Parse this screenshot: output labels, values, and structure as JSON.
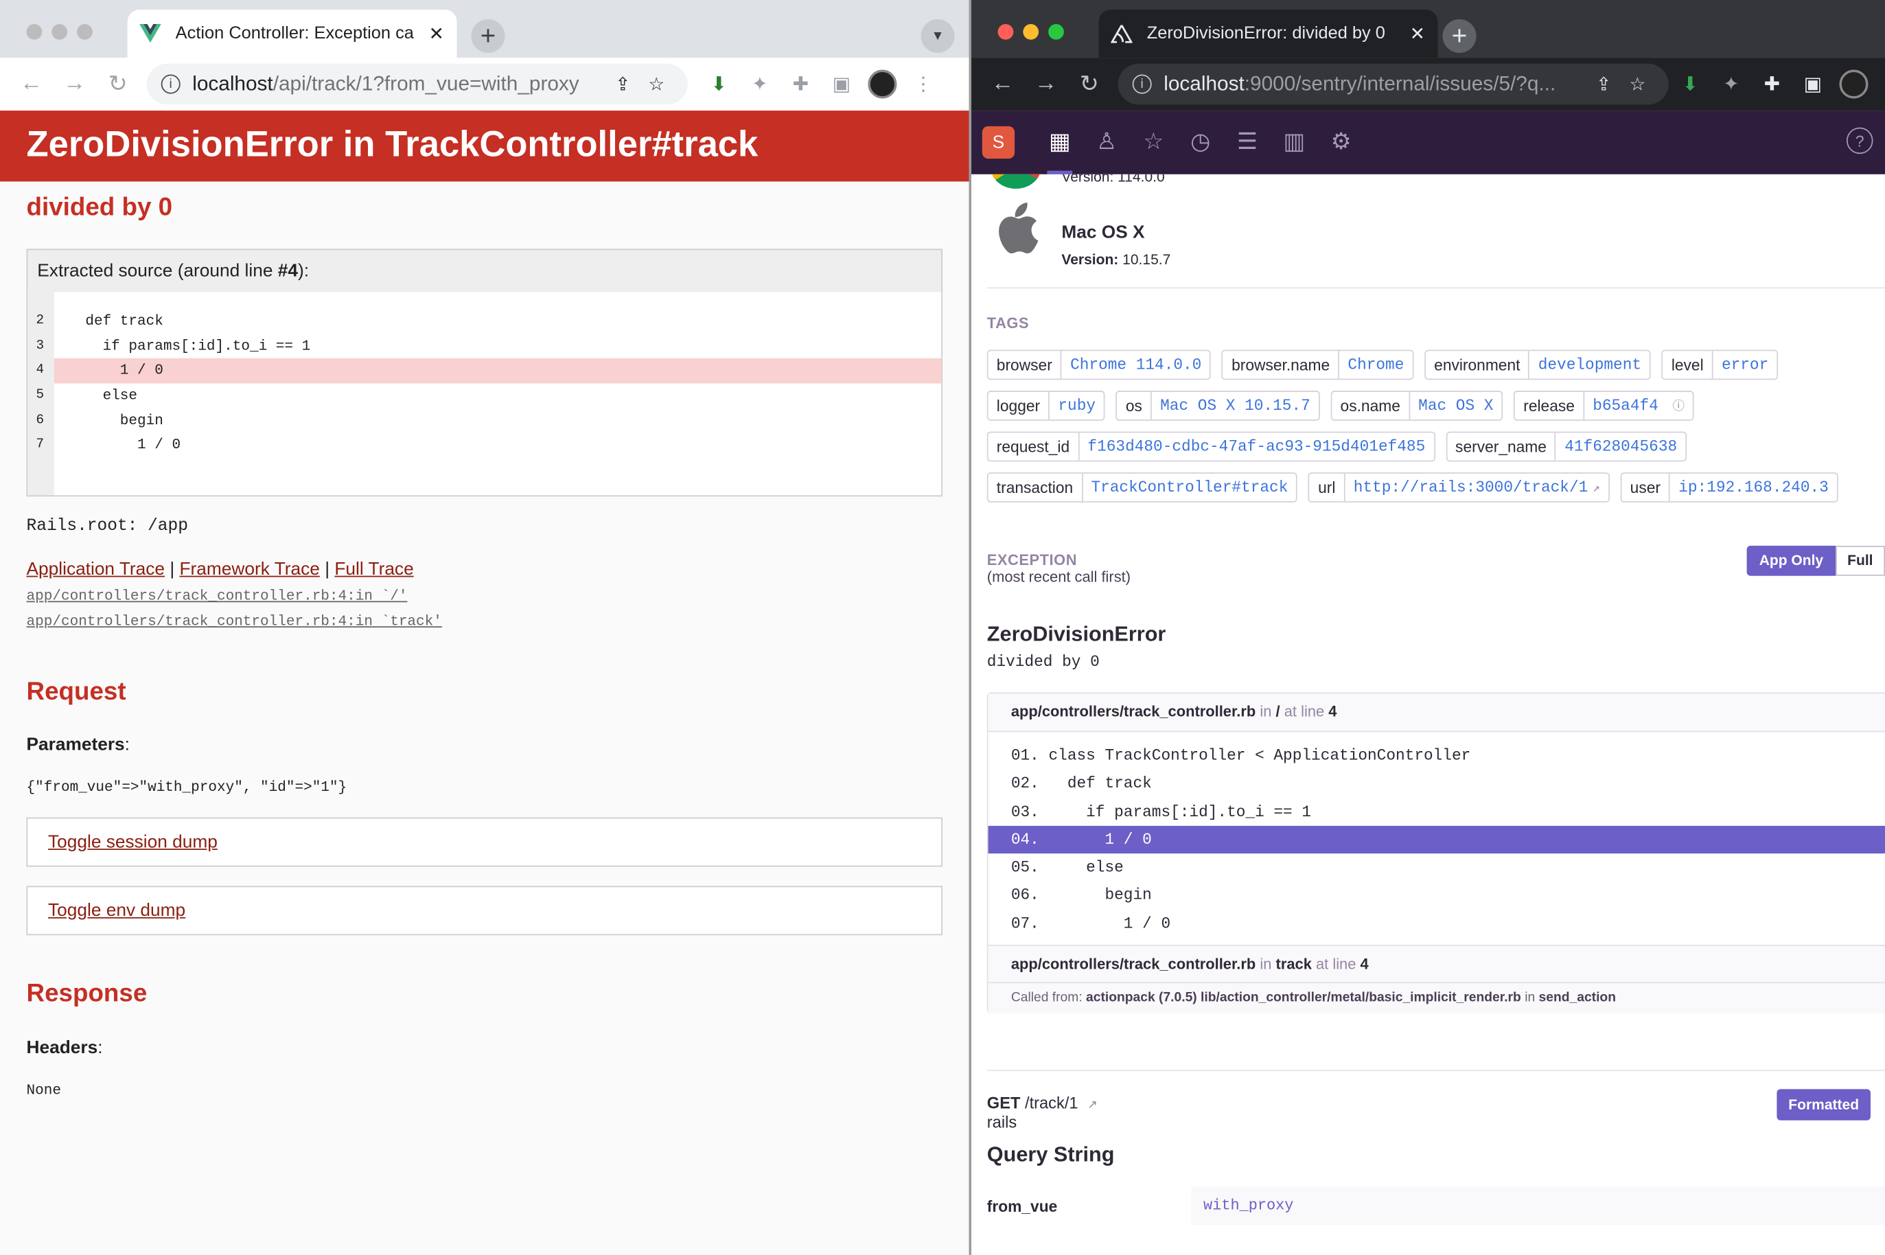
{
  "left_window": {
    "tab_title": "Action Controller: Exception ca",
    "url_host": "localhost",
    "url_path": "/api/track/1?from_vue=with_proxy",
    "header": "ZeroDivisionError in TrackController#track",
    "message": "divided by 0",
    "source_caption_pre": "Extracted source (around line ",
    "source_caption_line": "#4",
    "source_caption_post": "):",
    "source_lines": [
      {
        "num": "2",
        "text": "def track"
      },
      {
        "num": "3",
        "text": "  if params[:id].to_i == 1"
      },
      {
        "num": "4",
        "text": "    1 / 0"
      },
      {
        "num": "5",
        "text": "  else"
      },
      {
        "num": "6",
        "text": "    begin"
      },
      {
        "num": "7",
        "text": "      1 / 0"
      }
    ],
    "rails_root": "Rails.root: /app",
    "trace_links": [
      "Application Trace",
      "Framework Trace",
      "Full Trace"
    ],
    "trace_sep": "|",
    "trace_lines": [
      "app/controllers/track_controller.rb:4:in `/'",
      "app/controllers/track_controller.rb:4:in `track'"
    ],
    "request_heading": "Request",
    "parameters_label": "Parameters",
    "parameters_value": "{\"from_vue\"=>\"with_proxy\", \"id\"=>\"1\"}",
    "toggle_session": "Toggle session dump",
    "toggle_env": "Toggle env dump",
    "response_heading": "Response",
    "headers_label": "Headers",
    "headers_value": "None",
    "colon": ":"
  },
  "right_window": {
    "tab_title": "ZeroDivisionError: divided by 0",
    "url_host": "localhost",
    "url_path": ":9000/sentry/internal/issues/5/?q...",
    "org_initial": "S",
    "browser_version": "Version: 114.0.0",
    "os_name": "Mac OS X",
    "os_version_label": "Version:",
    "os_version": "10.15.7",
    "tags_heading": "TAGS",
    "tag_rows": [
      [
        {
          "k": "browser",
          "v": "Chrome 114.0.0"
        },
        {
          "k": "browser.name",
          "v": "Chrome"
        },
        {
          "k": "environment",
          "v": "development"
        },
        {
          "k": "level",
          "v": "error"
        }
      ],
      [
        {
          "k": "logger",
          "v": "ruby"
        },
        {
          "k": "os",
          "v": "Mac OS X 10.15.7"
        },
        {
          "k": "os.name",
          "v": "Mac OS X"
        },
        {
          "k": "release",
          "v": "b65a4f4"
        }
      ],
      [
        {
          "k": "request_id",
          "v": "f163d480-cdbc-47af-ac93-915d401ef485"
        },
        {
          "k": "server_name",
          "v": "41f628045638"
        }
      ],
      [
        {
          "k": "transaction",
          "v": "TrackController#track"
        },
        {
          "k": "url",
          "v": "http://rails:3000/track/1"
        },
        {
          "k": "user",
          "v": "ip:192.168.240.3"
        }
      ]
    ],
    "exception_heading": "EXCEPTION",
    "exception_sub": "(most recent call first)",
    "seg_app_only": "App Only",
    "seg_full": "Full",
    "exception_type": "ZeroDivisionError",
    "exception_value": "divided by 0",
    "frame1_file": "app/controllers/track_controller.rb",
    "frame_in": "in",
    "frame1_fn": "/",
    "frame_at_line": "at line",
    "frame1_line": "4",
    "frame_code": [
      {
        "num": "01.",
        "text": "class TrackController < ApplicationController"
      },
      {
        "num": "02.",
        "text": "  def track"
      },
      {
        "num": "03.",
        "text": "    if params[:id].to_i == 1"
      },
      {
        "num": "04.",
        "text": "      1 / 0"
      },
      {
        "num": "05.",
        "text": "    else"
      },
      {
        "num": "06.",
        "text": "      begin"
      },
      {
        "num": "07.",
        "text": "        1 / 0"
      }
    ],
    "frame2_file": "app/controllers/track_controller.rb",
    "frame2_fn": "track",
    "frame2_line": "4",
    "called_from_label": "Called from:",
    "called_from_pkg": "actionpack (7.0.5) lib/action_controller/metal/basic_implicit_render.rb",
    "called_from_fn": "send_action",
    "request_method": "GET",
    "request_path": "/track/1",
    "request_sub": "rails",
    "formatted_btn": "Formatted",
    "query_heading": "Query String",
    "query_key": "from_vue",
    "query_value": "with_proxy"
  },
  "colors": {
    "rails_red": "#c52f24",
    "sentry_purple": "#6c5fc7",
    "sentry_nav": "#2f1d3e",
    "tag_value": "#3d74db"
  }
}
